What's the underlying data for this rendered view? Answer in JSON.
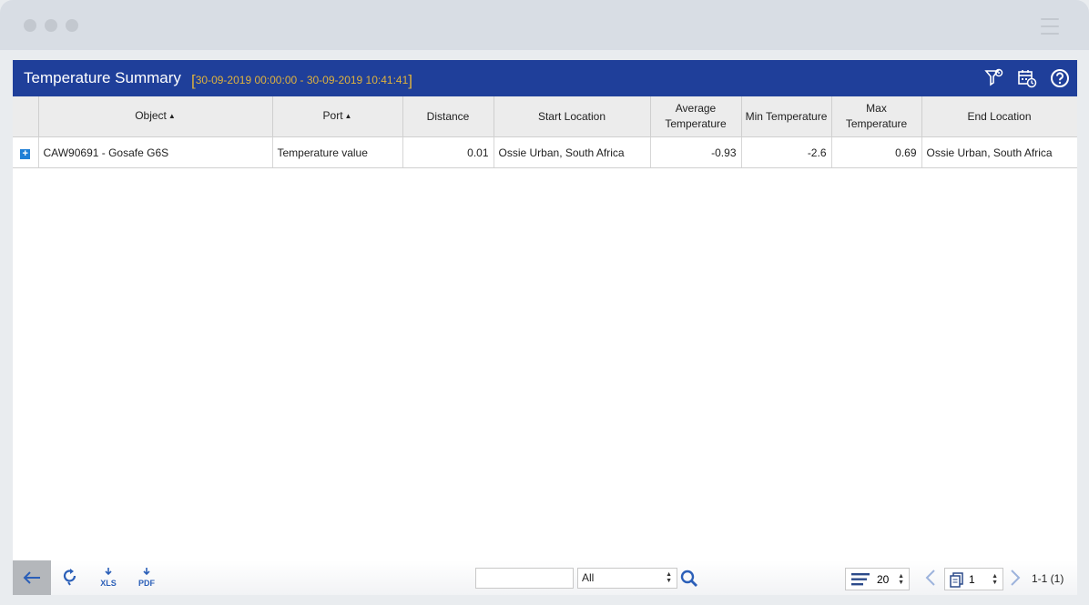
{
  "report": {
    "title": "Temperature Summary",
    "range_open": "[",
    "range": "30-09-2019 00:00:00 - 30-09-2019 10:41:41",
    "range_close": "]"
  },
  "columns": [
    {
      "label": "",
      "sort": ""
    },
    {
      "label": "Object",
      "sort": "▲"
    },
    {
      "label": "Port",
      "sort": "▲"
    },
    {
      "label": "Distance",
      "sort": ""
    },
    {
      "label": "Start Location",
      "sort": ""
    },
    {
      "label": "Average Temperature",
      "sort": ""
    },
    {
      "label": "Min Temperature",
      "sort": ""
    },
    {
      "label": "Max Temperature",
      "sort": ""
    },
    {
      "label": "End Location",
      "sort": ""
    }
  ],
  "rows": [
    {
      "expand": "+",
      "object": "CAW90691 - Gosafe G6S",
      "port": "Temperature value",
      "distance": "0.01",
      "start_location": "Ossie Urban, South Africa",
      "avg_temp": "-0.93",
      "min_temp": "-2.6",
      "max_temp": "0.69",
      "end_location": "Ossie Urban, South Africa"
    }
  ],
  "footer": {
    "xls_label": "XLS",
    "pdf_label": "PDF",
    "search_value": "",
    "filter_selected": "All",
    "rows_per_page": "20",
    "page": "1",
    "count": "1-1 (1)"
  },
  "colors": {
    "titlebar": "#1f3f9a",
    "range": "#e0b23c",
    "accent": "#2b5fb8"
  },
  "icons": [
    "filter-settings-icon",
    "calendar-clock-icon",
    "help-icon",
    "back-arrow-icon",
    "refresh-icon",
    "xls-download-icon",
    "pdf-download-icon",
    "search-icon",
    "rows-list-icon",
    "prev-page-icon",
    "page-icon",
    "next-page-icon",
    "expand-row-icon"
  ]
}
